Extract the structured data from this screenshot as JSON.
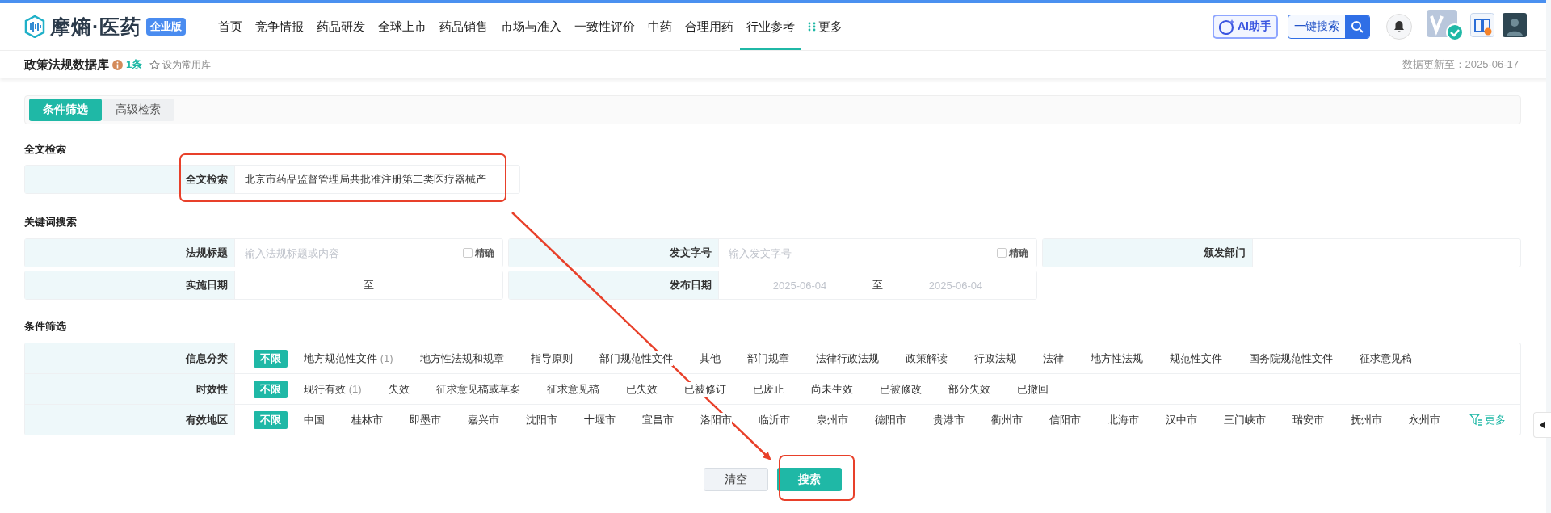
{
  "header": {
    "logo_text": "摩熵·医药",
    "edition_badge": "企业版",
    "nav": [
      {
        "label": "首页",
        "selected": false
      },
      {
        "label": "竞争情报",
        "selected": false
      },
      {
        "label": "药品研发",
        "selected": false
      },
      {
        "label": "全球上市",
        "selected": false
      },
      {
        "label": "药品销售",
        "selected": false
      },
      {
        "label": "市场与准入",
        "selected": false
      },
      {
        "label": "一致性评价",
        "selected": false
      },
      {
        "label": "中药",
        "selected": false
      },
      {
        "label": "合理用药",
        "selected": false
      },
      {
        "label": "行业参考",
        "selected": true
      }
    ],
    "more": "更多",
    "ai_button": "AI助手",
    "search_button": "一键搜索"
  },
  "subheader": {
    "title": "政策法规数据库",
    "count": "1条",
    "favorite": "设为常用库",
    "updated": "数据更新至：2025-06-17"
  },
  "tabs": [
    {
      "label": "条件筛选",
      "selected": true
    },
    {
      "label": "高级检索",
      "selected": false
    }
  ],
  "fulltext": {
    "heading": "全文检索",
    "label": "全文检索",
    "value": "北京市药品监督管理局共批准注册第二类医疗器械产",
    "highlighted": true
  },
  "keyword": {
    "heading": "关键词搜索",
    "fields": [
      {
        "kind": "text",
        "label": "法规标题",
        "placeholder": "输入法规标题或内容",
        "exact_label": "精确",
        "exact_checked": false
      },
      {
        "kind": "text",
        "label": "发文字号",
        "placeholder": "输入发文字号",
        "exact_label": "精确",
        "exact_checked": false
      },
      {
        "kind": "blank",
        "label": "颁发部门"
      },
      {
        "kind": "range",
        "label": "实施日期",
        "separator": "至"
      },
      {
        "kind": "range",
        "label": "发布日期",
        "from_placeholder": "2025-06-04",
        "separator": "至",
        "to_placeholder": "2025-06-04"
      }
    ]
  },
  "filters": {
    "heading": "条件筛选",
    "groups": [
      {
        "label": "信息分类",
        "options": [
          {
            "text": "不限",
            "selected": true
          },
          {
            "text": "地方规范性文件",
            "count": "(1)",
            "selected": false
          },
          {
            "text": "地方性法规和规章",
            "selected": false
          },
          {
            "text": "指导原则",
            "selected": false
          },
          {
            "text": "部门规范性文件",
            "selected": false
          },
          {
            "text": "其他",
            "selected": false
          },
          {
            "text": "部门规章",
            "selected": false
          },
          {
            "text": "法律行政法规",
            "selected": false
          },
          {
            "text": "政策解读",
            "selected": false
          },
          {
            "text": "行政法规",
            "selected": false
          },
          {
            "text": "法律",
            "selected": false
          },
          {
            "text": "地方性法规",
            "selected": false
          },
          {
            "text": "规范性文件",
            "selected": false
          },
          {
            "text": "国务院规范性文件",
            "selected": false
          },
          {
            "text": "征求意见稿",
            "selected": false
          }
        ]
      },
      {
        "label": "时效性",
        "options": [
          {
            "text": "不限",
            "selected": true
          },
          {
            "text": "现行有效",
            "count": "(1)",
            "selected": false
          },
          {
            "text": "失效",
            "selected": false
          },
          {
            "text": "征求意见稿或草案",
            "selected": false
          },
          {
            "text": "征求意见稿",
            "selected": false
          },
          {
            "text": "已失效",
            "selected": false
          },
          {
            "text": "已被修订",
            "selected": false
          },
          {
            "text": "已废止",
            "selected": false
          },
          {
            "text": "尚未生效",
            "selected": false
          },
          {
            "text": "已被修改",
            "selected": false
          },
          {
            "text": "部分失效",
            "selected": false
          },
          {
            "text": "已撤回",
            "selected": false
          }
        ]
      },
      {
        "label": "有效地区",
        "more": "更多",
        "options": [
          {
            "text": "不限",
            "selected": true
          },
          {
            "text": "中国",
            "selected": false
          },
          {
            "text": "桂林市",
            "selected": false
          },
          {
            "text": "即墨市",
            "selected": false
          },
          {
            "text": "嘉兴市",
            "selected": false
          },
          {
            "text": "沈阳市",
            "selected": false
          },
          {
            "text": "十堰市",
            "selected": false
          },
          {
            "text": "宜昌市",
            "selected": false
          },
          {
            "text": "洛阳市",
            "selected": false
          },
          {
            "text": "临沂市",
            "selected": false
          },
          {
            "text": "泉州市",
            "selected": false
          },
          {
            "text": "德阳市",
            "selected": false
          },
          {
            "text": "贵港市",
            "selected": false
          },
          {
            "text": "衢州市",
            "selected": false
          },
          {
            "text": "信阳市",
            "selected": false
          },
          {
            "text": "北海市",
            "selected": false
          },
          {
            "text": "汉中市",
            "selected": false
          },
          {
            "text": "三门峡市",
            "selected": false
          },
          {
            "text": "瑞安市",
            "selected": false
          },
          {
            "text": "抚州市",
            "selected": false
          },
          {
            "text": "永州市",
            "selected": false
          }
        ]
      }
    ]
  },
  "actions": {
    "clear": "清空",
    "search": "搜索",
    "search_highlighted": true
  },
  "annotations": [
    {
      "kind": "arrow"
    }
  ]
}
